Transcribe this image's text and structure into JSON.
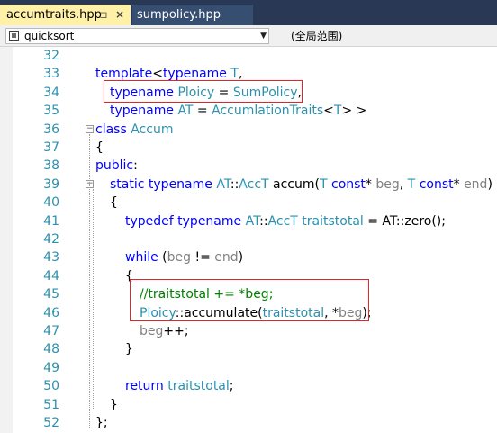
{
  "tabs": [
    {
      "label": "accumtraits.hpp",
      "active": true,
      "pin": "⊐",
      "close": "×"
    },
    {
      "label": "sumpolicy.hpp",
      "active": false
    }
  ],
  "navbar": {
    "scope": "quicksort",
    "member": "(全局范围)"
  },
  "colors": {
    "keyword": "#0000ff",
    "type": "#2b91af",
    "comment": "#008000",
    "line_number": "#2b91af",
    "highlight_box": "#e0262d",
    "active_tab": "#fff1a8",
    "tab_strip": "#293955"
  },
  "lines": [
    {
      "n": "32",
      "tokens": []
    },
    {
      "n": "33",
      "tokens": [
        [
          "kw",
          "template"
        ],
        [
          "fn",
          "<"
        ],
        [
          "kw",
          "typename"
        ],
        [
          "fn",
          " "
        ],
        [
          "ty",
          "T"
        ],
        [
          "fn",
          ","
        ]
      ]
    },
    {
      "n": "34",
      "tokens": [
        [
          "kw",
          "typename"
        ],
        [
          "fn",
          " "
        ],
        [
          "ty",
          "Ploicy"
        ],
        [
          "fn",
          " = "
        ],
        [
          "ty",
          "SumPolicy"
        ],
        [
          "fn",
          ","
        ]
      ]
    },
    {
      "n": "35",
      "tokens": [
        [
          "kw",
          "typename"
        ],
        [
          "fn",
          " "
        ],
        [
          "ty",
          "AT"
        ],
        [
          "fn",
          " = "
        ],
        [
          "ty",
          "AccumlationTraits"
        ],
        [
          "fn",
          "<"
        ],
        [
          "ty",
          "T"
        ],
        [
          "fn",
          "> >"
        ]
      ]
    },
    {
      "n": "36",
      "tokens": [
        [
          "kw",
          "class"
        ],
        [
          "fn",
          " "
        ],
        [
          "ty",
          "Accum"
        ]
      ]
    },
    {
      "n": "37",
      "tokens": [
        [
          "fn",
          "{"
        ]
      ]
    },
    {
      "n": "38",
      "tokens": [
        [
          "kw",
          "public"
        ],
        [
          "fn",
          ":"
        ]
      ]
    },
    {
      "n": "39",
      "tokens": [
        [
          "kw",
          "static"
        ],
        [
          "fn",
          " "
        ],
        [
          "kw",
          "typename"
        ],
        [
          "fn",
          " "
        ],
        [
          "ty",
          "AT"
        ],
        [
          "fn",
          "::"
        ],
        [
          "ty",
          "AccT"
        ],
        [
          "fn",
          " accum("
        ],
        [
          "ty",
          "T"
        ],
        [
          "fn",
          " "
        ],
        [
          "kw",
          "const"
        ],
        [
          "fn",
          "* "
        ],
        [
          "pm",
          "beg"
        ],
        [
          "fn",
          ", "
        ],
        [
          "ty",
          "T"
        ],
        [
          "fn",
          " "
        ],
        [
          "kw",
          "const"
        ],
        [
          "fn",
          "* "
        ],
        [
          "pm",
          "end"
        ],
        [
          "fn",
          ")"
        ]
      ]
    },
    {
      "n": "40",
      "tokens": [
        [
          "fn",
          "{"
        ]
      ]
    },
    {
      "n": "41",
      "tokens": [
        [
          "kw",
          "typedef"
        ],
        [
          "fn",
          " "
        ],
        [
          "kw",
          "typename"
        ],
        [
          "fn",
          " "
        ],
        [
          "ty",
          "AT"
        ],
        [
          "fn",
          "::"
        ],
        [
          "ty",
          "AccT"
        ],
        [
          "fn",
          " "
        ],
        [
          "ty",
          "traitstotal"
        ],
        [
          "fn",
          " = AT::zero();"
        ]
      ]
    },
    {
      "n": "42",
      "tokens": []
    },
    {
      "n": "43",
      "tokens": [
        [
          "kw",
          "while"
        ],
        [
          "fn",
          " ("
        ],
        [
          "pm",
          "beg"
        ],
        [
          "fn",
          " != "
        ],
        [
          "pm",
          "end"
        ],
        [
          "fn",
          ")"
        ]
      ]
    },
    {
      "n": "44",
      "tokens": [
        [
          "fn",
          "{"
        ]
      ]
    },
    {
      "n": "45",
      "tokens": [
        [
          "cm",
          "//traitstotal += *beg;"
        ]
      ]
    },
    {
      "n": "46",
      "tokens": [
        [
          "ty",
          "Ploicy"
        ],
        [
          "fn",
          "::accumulate("
        ],
        [
          "ty",
          "traitstotal"
        ],
        [
          "fn",
          ", *"
        ],
        [
          "pm",
          "beg"
        ],
        [
          "fn",
          ");"
        ]
      ]
    },
    {
      "n": "47",
      "tokens": [
        [
          "pm",
          "beg"
        ],
        [
          "fn",
          "++;"
        ]
      ]
    },
    {
      "n": "48",
      "tokens": [
        [
          "fn",
          "}"
        ]
      ]
    },
    {
      "n": "49",
      "tokens": []
    },
    {
      "n": "50",
      "tokens": [
        [
          "kw",
          "return"
        ],
        [
          "fn",
          " "
        ],
        [
          "ty",
          "traitstotal"
        ],
        [
          "fn",
          ";"
        ]
      ]
    },
    {
      "n": "51",
      "tokens": [
        [
          "fn",
          "}"
        ]
      ]
    },
    {
      "n": "52",
      "tokens": [
        [
          "fn",
          "};"
        ]
      ]
    }
  ]
}
